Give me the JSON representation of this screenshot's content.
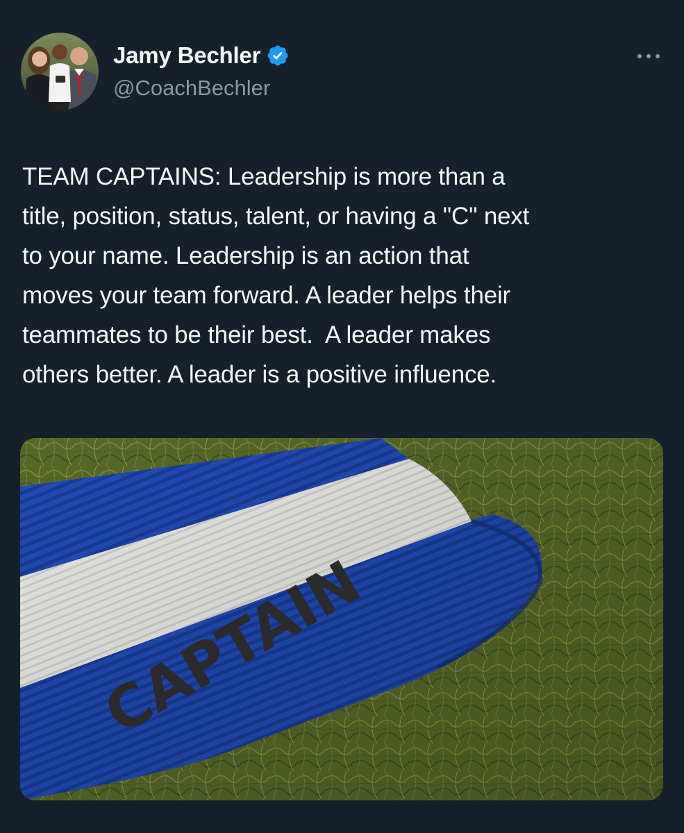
{
  "author": {
    "display_name": "Jamy Bechler",
    "handle": "@CoachBechler",
    "verified": true,
    "avatar_icon": "profile-photo-family"
  },
  "menu": {
    "icon": "more-options-icon"
  },
  "tweet": {
    "text": "TEAM CAPTAINS: Leadership is more than a\ntitle, position, status, talent, or having a \"C\" next\nto your name. Leadership is an action that\nmoves your team forward. A leader helps their\nteammates to be their best.  A leader makes\nothers better. A leader is a positive influence."
  },
  "media": {
    "armband_label": "CAPTAIN"
  },
  "colors": {
    "background": "#15202b",
    "text_primary": "#f7f9f9",
    "text_secondary": "#8b98a5",
    "verified_blue": "#1d9bf0",
    "armband_blue": "#1f47b0",
    "grass_green": "#5a6e2a"
  }
}
